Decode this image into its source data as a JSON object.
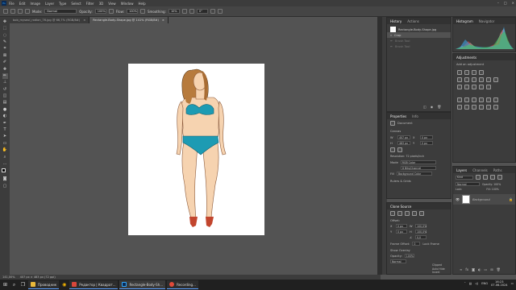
{
  "app": {
    "logo": "Ps"
  },
  "menu": [
    "File",
    "Edit",
    "Image",
    "Layer",
    "Type",
    "Select",
    "Filter",
    "3D",
    "View",
    "Window",
    "Help"
  ],
  "options": {
    "mode_label": "Mode:",
    "mode_value": "Normal",
    "opacity_label": "Opacity:",
    "opacity_value": "100%",
    "flow_label": "Flow:",
    "flow_value": "100%",
    "smoothing_label": "Smoothing:",
    "smoothing_value": "10%",
    "angle_value": "0°"
  },
  "tabs": [
    {
      "label": "bob_myseol_rodion_76.jpg @ 66,7% (RGB/8#)",
      "close": "×"
    },
    {
      "label": "Rectangle-Body-Shape.jpg @ 141% (RGB/8#)",
      "close": "×"
    }
  ],
  "status": {
    "zoom": "141,00%",
    "size": "407 px × 483 px (72 ppi)"
  },
  "history": {
    "tabs": [
      "History",
      "Actions"
    ],
    "doc": "Rectangle-Body-Shape.jpg",
    "items": [
      "Crop",
      "Brush Tool",
      "Brush Tool"
    ]
  },
  "histogram": {
    "tabs": [
      "Histogram",
      "Navigator"
    ]
  },
  "adjustments": {
    "tabs": [
      "Adjustments"
    ],
    "title": "Add an adjustment"
  },
  "properties": {
    "tabs": [
      "Properties",
      "Info"
    ],
    "doc_label": "Document",
    "canvas": "Canvas",
    "w": "407 px",
    "h": "483 px",
    "x": "0 px",
    "y": "0 px",
    "resolution": "Resolution: 72 pixels/inch",
    "mode_label": "Mode",
    "mode": "RGB Color",
    "depth": "8 Bits/Channel",
    "fill": "Background Color",
    "rulers": "Rulers & Grids"
  },
  "clone_source": {
    "tabs": [
      "Clone Source"
    ],
    "offset": "Offset:",
    "x": "0 px",
    "y": "0 px",
    "w": "100,0%",
    "h": "100,0%",
    "angle": "0,0",
    "frame_offset": "Frame Offset:",
    "frame_offset_value": "0",
    "lock_frame": "Lock Frame",
    "show_overlay": "Show Overlay",
    "opacity_label": "Opacity:",
    "opacity": "100%",
    "mode": "Normal",
    "clipped": "Clipped",
    "auto_hide": "Auto Hide",
    "invert": "Invert"
  },
  "layers": {
    "tabs": [
      "Layers",
      "Channels",
      "Paths"
    ],
    "kind": "Kind",
    "mode": "Normal",
    "opacity": "Opacity: 100%",
    "lock": "Lock:",
    "fill": "Fill: 100%",
    "layer_name": "Background"
  },
  "taskbar": {
    "items": [
      {
        "label": "Проводник",
        "color": "#e8b83a"
      },
      {
        "label": "Редактор | Квадрат...",
        "color": "#d9473b"
      },
      {
        "label": "Rectangle-Body-Sh...",
        "color": "#31a8ff"
      },
      {
        "label": "Recording...",
        "color": "#e04a3a"
      }
    ],
    "lang": "ENG",
    "time": "16:23",
    "date": "07.06.2024"
  }
}
